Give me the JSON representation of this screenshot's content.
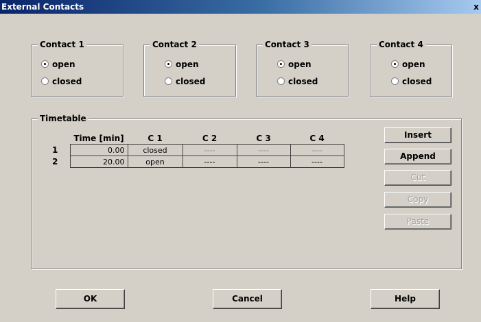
{
  "window": {
    "title": "External Contacts",
    "close_label": "x"
  },
  "contacts": [
    {
      "label": "Contact 1",
      "options": [
        "open",
        "closed"
      ],
      "selected": "open"
    },
    {
      "label": "Contact 2",
      "options": [
        "open",
        "closed"
      ],
      "selected": "open"
    },
    {
      "label": "Contact 3",
      "options": [
        "open",
        "closed"
      ],
      "selected": "open"
    },
    {
      "label": "Contact 4",
      "options": [
        "open",
        "closed"
      ],
      "selected": "open"
    }
  ],
  "timetable": {
    "label": "Timetable",
    "headers": [
      "Time [min]",
      "C 1",
      "C 2",
      "C 3",
      "C 4"
    ],
    "rows": [
      {
        "index": "1",
        "time": "0.00",
        "c1": "closed",
        "c2": "----",
        "c3": "----",
        "c4": "----"
      },
      {
        "index": "2",
        "time": "20.00",
        "c1": "open",
        "c2": "----",
        "c3": "----",
        "c4": "----"
      }
    ],
    "buttons": {
      "insert": "Insert",
      "append": "Append",
      "cut": "Cut",
      "copy": "Copy",
      "paste": "Paste"
    }
  },
  "footer": {
    "ok": "OK",
    "cancel": "Cancel",
    "help": "Help"
  }
}
